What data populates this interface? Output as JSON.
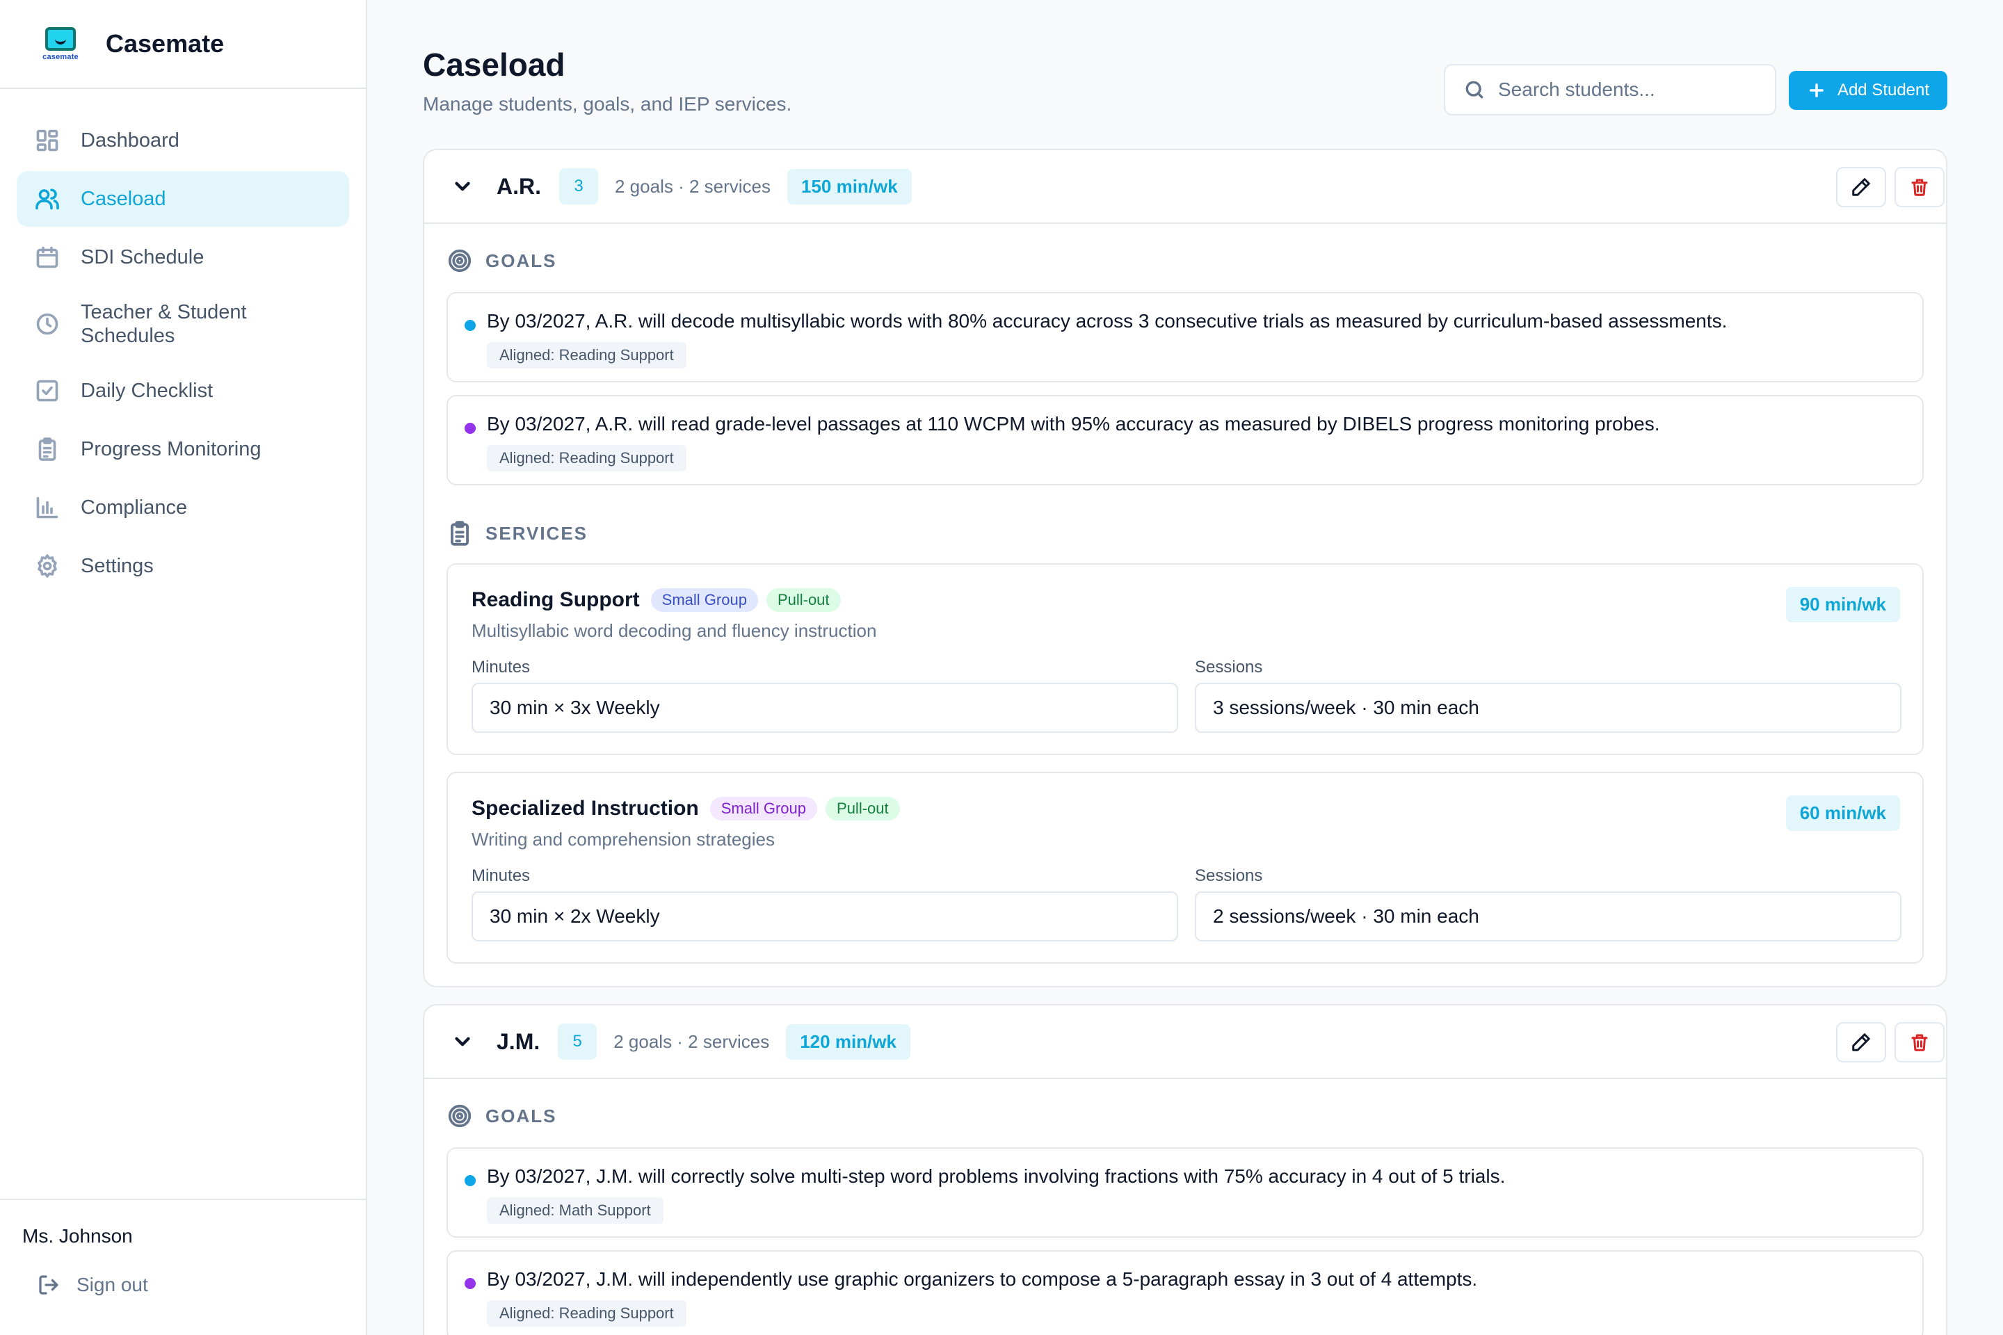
{
  "app": {
    "name": "Casemate",
    "logo_text": "casemate"
  },
  "sidebar": {
    "items": [
      {
        "label": "Dashboard",
        "icon": "grid-icon"
      },
      {
        "label": "Caseload",
        "icon": "users-icon",
        "active": true
      },
      {
        "label": "SDI Schedule",
        "icon": "calendar-icon"
      },
      {
        "label": "Teacher & Student Schedules",
        "icon": "clock-icon"
      },
      {
        "label": "Daily Checklist",
        "icon": "checkbox-icon"
      },
      {
        "label": "Progress Monitoring",
        "icon": "clipboard-icon"
      },
      {
        "label": "Compliance",
        "icon": "bar-chart-icon"
      },
      {
        "label": "Settings",
        "icon": "gear-icon"
      }
    ],
    "user": "Ms. Johnson",
    "signout": "Sign out"
  },
  "header": {
    "title": "Caseload",
    "subtitle": "Manage students, goals, and IEP services.",
    "search_placeholder": "Search students...",
    "add_button": "Add Student"
  },
  "colors": {
    "accent": "#0ea5e9",
    "accent_soft": "#e3f6fb",
    "goal_dot_1": "#0ea5e9",
    "goal_dot_2": "#9333ea",
    "danger": "#dc2626"
  },
  "sections": {
    "goals": "GOALS",
    "services": "SERVICES",
    "minutes_label": "Minutes",
    "sessions_label": "Sessions"
  },
  "students": [
    {
      "name": "A.R.",
      "grade": "3",
      "counts": "2 goals · 2 services",
      "minutes": "150 min/wk",
      "goals": [
        {
          "text": "By 03/2027, A.R. will decode multisyllabic words with 80% accuracy across 3 consecutive trials as measured by curriculum-based assessments.",
          "aligned": "Aligned: Reading Support"
        },
        {
          "text": "By 03/2027, A.R. will read grade-level passages at 110 WCPM with 95% accuracy as measured by DIBELS progress monitoring probes.",
          "aligned": "Aligned: Reading Support"
        }
      ],
      "services": [
        {
          "name": "Reading Support",
          "tag1": "Small Group",
          "tag2": "Pull-out",
          "desc": "Multisyllabic word decoding and fluency instruction",
          "minutes": "90 min/wk",
          "minutes_value": "30 min × 3x Weekly",
          "sessions_value": "3 sessions/week · 30 min each"
        },
        {
          "name": "Specialized Instruction",
          "tag1": "Small Group",
          "tag2": "Pull-out",
          "desc": "Writing and comprehension strategies",
          "minutes": "60 min/wk",
          "minutes_value": "30 min × 2x Weekly",
          "sessions_value": "2 sessions/week · 30 min each"
        }
      ]
    },
    {
      "name": "J.M.",
      "grade": "5",
      "counts": "2 goals · 2 services",
      "minutes": "120 min/wk",
      "goals": [
        {
          "text": "By 03/2027, J.M. will correctly solve multi-step word problems involving fractions with 75% accuracy in 4 out of 5 trials.",
          "aligned": "Aligned: Math Support"
        },
        {
          "text": "By 03/2027, J.M. will independently use graphic organizers to compose a 5-paragraph essay in 3 out of 4 attempts.",
          "aligned": "Aligned: Reading Support"
        }
      ]
    }
  ]
}
